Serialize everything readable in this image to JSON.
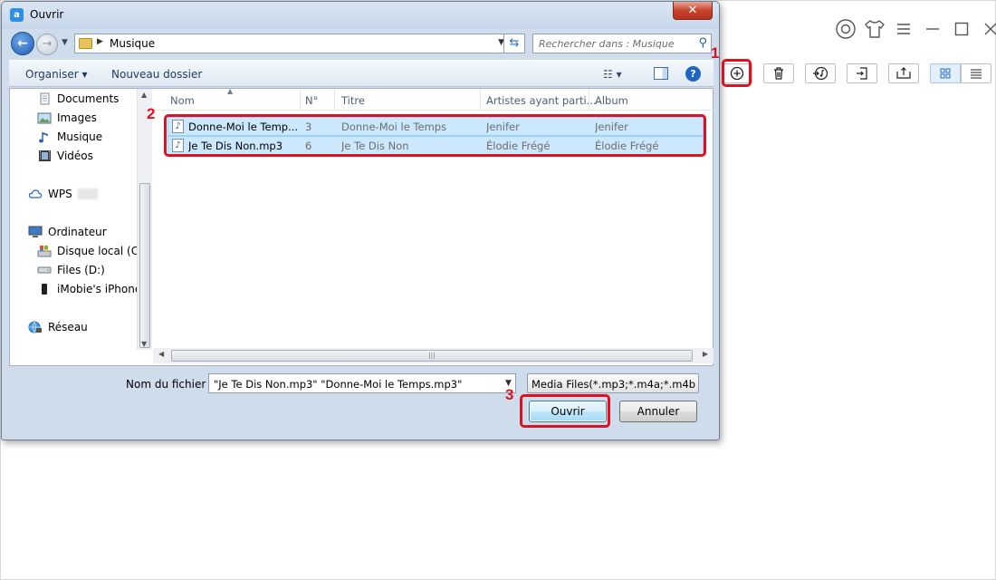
{
  "app": {
    "top_icons": [
      "account-icon",
      "skin-icon",
      "menu-icon",
      "minimize-icon",
      "maximize-icon",
      "close-icon"
    ],
    "toolbar": [
      "add-icon",
      "delete-icon",
      "to-itunes-icon",
      "import-icon",
      "export-icon",
      "grid-view-icon",
      "list-view-icon"
    ]
  },
  "dialog": {
    "title": "Ouvrir",
    "close_glyph": "✕",
    "breadcrumb": "Musique",
    "search_placeholder": "Rechercher dans : Musique",
    "commands": {
      "organize": "Organiser ▾",
      "new_folder": "Nouveau dossier"
    },
    "nav": [
      {
        "label": "Documents",
        "icon": "documents-icon"
      },
      {
        "label": "Images",
        "icon": "images-icon"
      },
      {
        "label": "Musique",
        "icon": "music-icon"
      },
      {
        "label": "Vidéos",
        "icon": "videos-icon"
      },
      {
        "label": "WPS",
        "icon": "cloud-icon"
      },
      {
        "label": "Ordinateur",
        "icon": "computer-icon"
      },
      {
        "label": "Disque local (C:)",
        "icon": "drive-icon"
      },
      {
        "label": "Files (D:)",
        "icon": "drive-icon"
      },
      {
        "label": "iMobie's iPhone",
        "icon": "phone-icon"
      },
      {
        "label": "Réseau",
        "icon": "network-icon"
      }
    ],
    "columns": {
      "name": "Nom",
      "number": "N°",
      "title": "Titre",
      "artists": "Artistes ayant parti...",
      "album": "Album"
    },
    "files": [
      {
        "name": "Donne-Moi le Temp...",
        "number": "3",
        "title": "Donne-Moi le Temps",
        "artist": "Jenifer",
        "album": "Jenifer"
      },
      {
        "name": "Je Te Dis Non.mp3",
        "number": "6",
        "title": "Je Te Dis Non",
        "artist": "Élodie Frégé",
        "album": "Élodie Frégé"
      }
    ],
    "filename_label": "Nom du fichier :",
    "filename_value": "\"Je Te Dis Non.mp3\" \"Donne-Moi le Temps.mp3\"",
    "filter_value": "Media Files(*.mp3;*.m4a;*.m4b",
    "open_label": "Ouvrir",
    "cancel_label": "Annuler"
  },
  "callouts": [
    "1",
    "2",
    "3"
  ],
  "colors": {
    "callout": "#e0101f",
    "selection": "#cce8ff"
  }
}
